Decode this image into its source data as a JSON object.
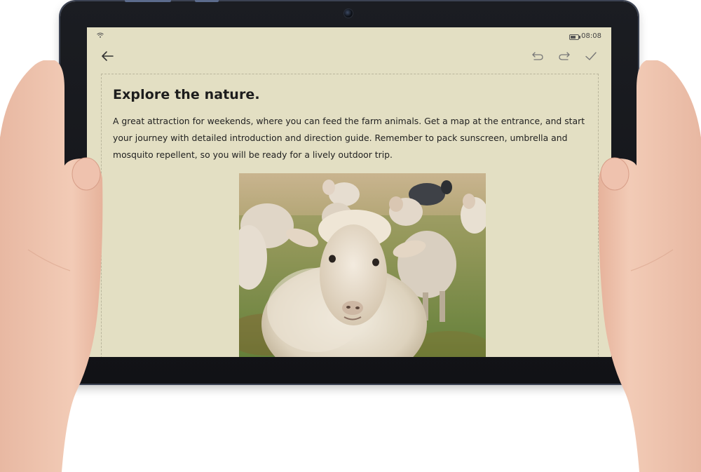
{
  "status_bar": {
    "time": "08:08",
    "wifi_icon": "wifi-icon",
    "battery_icon": "battery-icon",
    "battery_level": 0.7
  },
  "toolbar": {
    "back_icon": "arrow-left-icon",
    "undo_icon": "undo-icon",
    "redo_icon": "redo-icon",
    "done_icon": "checkmark-icon"
  },
  "document": {
    "title": "Explore the nature.",
    "body": "A great attraction for weekends, where you can feed the farm animals. Get a map at the entrance, and start your journey with detailed introduction and direction guide. Remember to pack sunscreen, umbrella and mosquito repellent, so you will be ready for a lively outdoor trip."
  },
  "colors": {
    "screen_background": "#e3dfc3",
    "tablet_frame": "#16181d",
    "text": "#1d1d1d"
  }
}
